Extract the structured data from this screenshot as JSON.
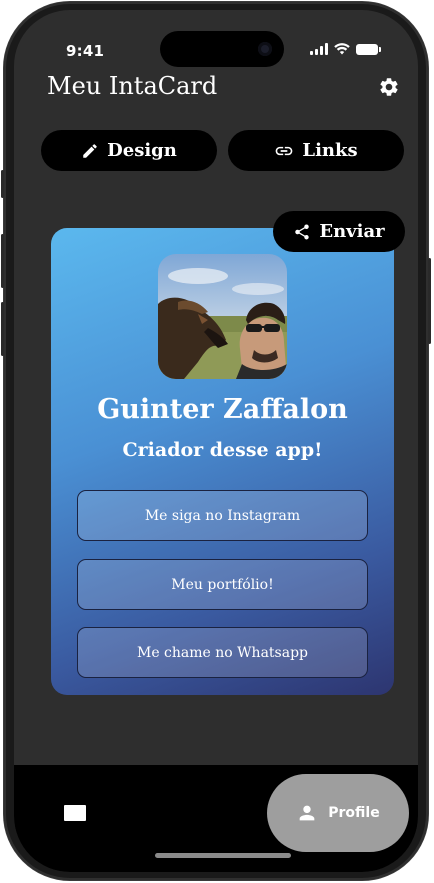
{
  "status_bar": {
    "time": "9:41"
  },
  "header": {
    "title": "Meu IntaCard",
    "settings_icon": "gear-icon"
  },
  "tabs": {
    "design_label": "Design",
    "links_label": "Links"
  },
  "share": {
    "label": "Enviar"
  },
  "card": {
    "name": "Guinter Zaffalon",
    "subtitle": "Criador desse app!",
    "links": [
      {
        "label": "Me siga no Instagram"
      },
      {
        "label": "Meu portfólio!"
      },
      {
        "label": "Me chame no Whatsapp"
      }
    ],
    "gradient_colors": [
      "#5bb8ee",
      "#4a90d4",
      "#3a5aa0",
      "#2d3570"
    ]
  },
  "bottom_nav": {
    "profile_label": "Profile",
    "active_color": "#9e9e9e"
  }
}
